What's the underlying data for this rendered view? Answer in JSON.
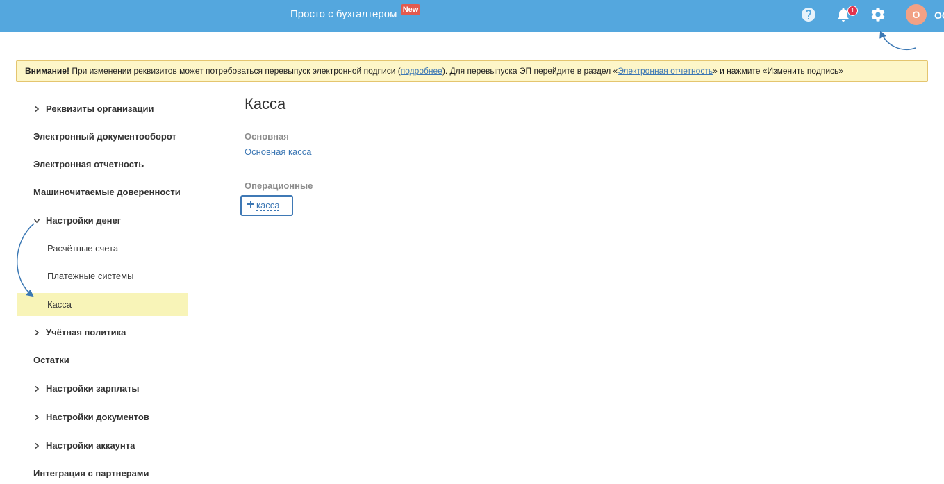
{
  "header": {
    "title": "Просто с бухгалтером",
    "new_badge": "New",
    "help_icon": "help-icon",
    "notifications_icon": "bell-icon",
    "notification_count": "1",
    "settings_icon": "gear-icon",
    "avatar_letter": "О",
    "user_name": "ОС"
  },
  "alert": {
    "strong": "Внимание!",
    "text_1": " При изменении реквизитов может потребоваться перевыпуск электронной подписи (",
    "link_details": "подробнее",
    "text_2": "). Для перевыпуска ЭП перейдите в раздел «",
    "link_reporting": "Электронная отчетность",
    "text_3": "» и нажмите «Изменить подпись»"
  },
  "sidebar": {
    "items": [
      {
        "label": "Реквизиты организации",
        "icon": "chevron-right-icon"
      },
      {
        "label": "Электронный документооборот"
      },
      {
        "label": "Электронная отчетность"
      },
      {
        "label": "Машиночитаемые доверенности"
      },
      {
        "label": "Настройки денег",
        "icon": "chevron-down-icon",
        "children": [
          {
            "label": "Расчётные счета"
          },
          {
            "label": "Платежные системы"
          },
          {
            "label": "Касса",
            "active": true
          }
        ]
      },
      {
        "label": "Учётная политика",
        "icon": "chevron-right-icon"
      },
      {
        "label": "Остатки"
      },
      {
        "label": "Настройки зарплаты",
        "icon": "chevron-right-icon"
      },
      {
        "label": "Настройки документов",
        "icon": "chevron-right-icon"
      },
      {
        "label": "Настройки аккаунта",
        "icon": "chevron-right-icon"
      },
      {
        "label": "Интеграция с партнерами"
      }
    ]
  },
  "main": {
    "title": "Касса",
    "primary_section_label": "Основная",
    "primary_cash_desk": "Основная касса",
    "operational_section_label": "Операционные",
    "add_cash_desk_label": "касса",
    "add_icon": "plus-icon"
  },
  "colors": {
    "header_bg": "#54a7de",
    "new_badge": "#e25a4f",
    "notification_badge": "#e3334c",
    "avatar_bg": "#f2a185",
    "alert_bg": "#fdf6c8",
    "alert_border": "#e4c56f",
    "active_item_bg": "#f8f4b8",
    "link": "#3c77b4",
    "annotation": "#3b78b4"
  }
}
